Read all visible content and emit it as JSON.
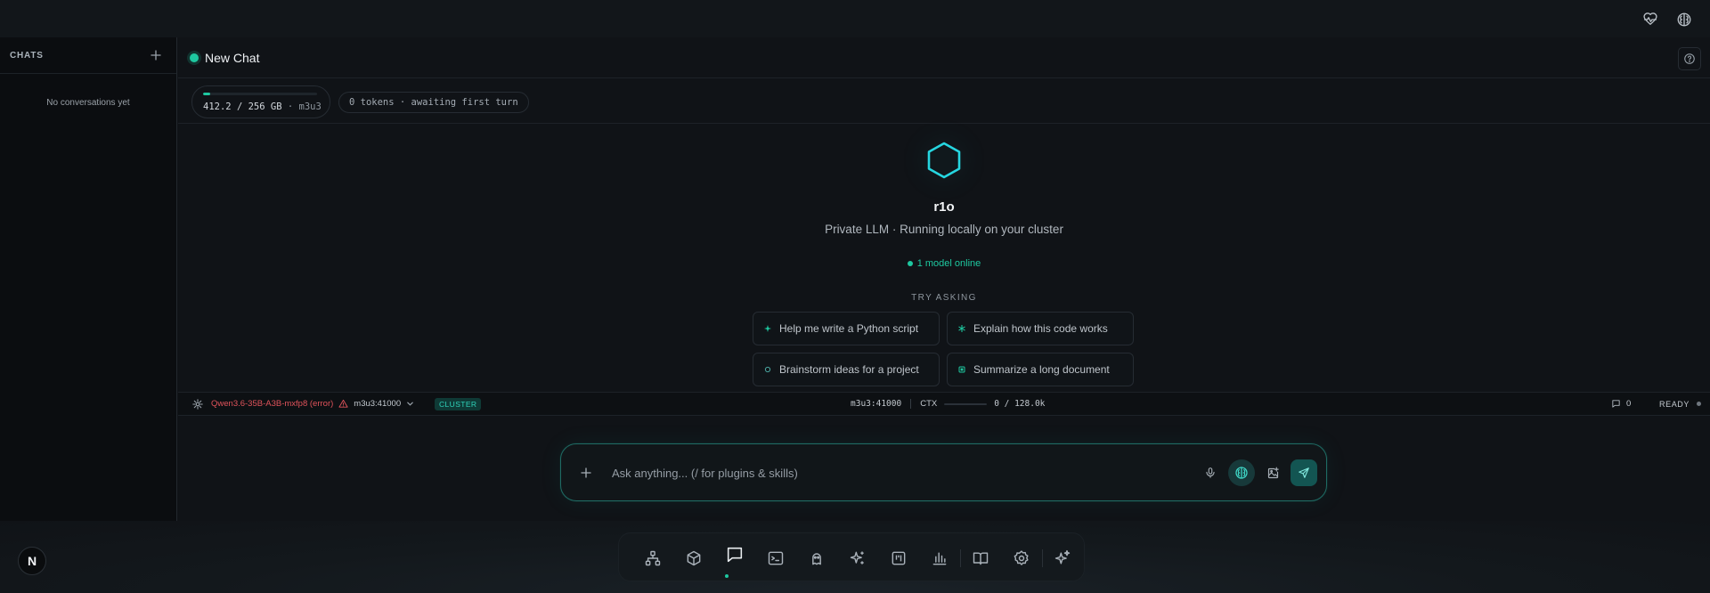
{
  "sidebar": {
    "title": "CHATS",
    "empty_text": "No conversations yet"
  },
  "header": {
    "title": "New Chat"
  },
  "stats": {
    "memory_used": "412.2",
    "memory_total": "256 GB",
    "memory_separator": "/",
    "memory_host": "m3u3",
    "memory_fraction": 0.06,
    "tokens_text": "0 tokens · awaiting first turn"
  },
  "welcome": {
    "app_name": "r1o",
    "tagline": "Private LLM · Running locally on your cluster",
    "model_status": "1 model online",
    "try_label": "TRY ASKING",
    "suggestions": [
      "Help me write a Python script",
      "Explain how this code works",
      "Brainstorm ideas for a project",
      "Summarize a long document"
    ]
  },
  "status_bar": {
    "model_error": "Qwen3.6-35B-A3B-mxfp8 (error)",
    "host": "m3u3:41000",
    "cluster_badge": "CLUSTER",
    "endpoint": "m3u3:41000",
    "ctx_label": "CTX",
    "ctx_value": "0 / 128.0k",
    "messages_count": "0",
    "ready_label": "READY"
  },
  "composer": {
    "placeholder": "Ask anything... (/ for plugins & skills)",
    "value": ""
  },
  "dock": {
    "avatar_letter": "N",
    "active_index": 2
  },
  "colors": {
    "accent": "#1ec8a0",
    "hex_logo": "#26d6e0",
    "error": "#e0535b",
    "background": "#101317"
  }
}
